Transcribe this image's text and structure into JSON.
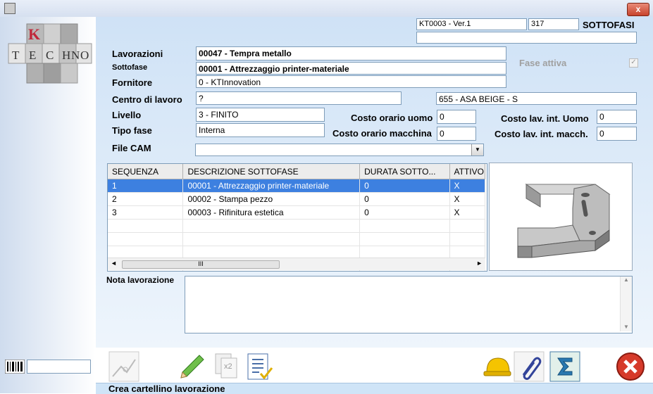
{
  "window": {
    "close_label": "x"
  },
  "header": {
    "code": "KT0003 - Ver.1",
    "number": "317",
    "title": "SOTTOFASI",
    "extra": ""
  },
  "logo": {
    "letters": [
      "K",
      "T",
      "E",
      "C",
      "H",
      "N",
      "O"
    ]
  },
  "form": {
    "lavorazioni_label": "Lavorazioni",
    "lavorazioni_value": "00047 - Tempra metallo",
    "sottofase_label": "Sottofase",
    "sottofase_value": "00001 - Attrezzaggio printer-materiale",
    "fornitore_label": "Fornitore",
    "fornitore_value": "0 - KTInnovation",
    "fase_attiva_label": "Fase attiva",
    "fase_attiva_checked": "✓",
    "centro_label": "Centro di lavoro",
    "centro_value": "?",
    "centro_desc": "655 - ASA BEIGE - S",
    "livello_label": "Livello",
    "livello_value": "3 - FINITO",
    "costo_orario_uomo_label": "Costo orario uomo",
    "costo_orario_uomo_value": "0",
    "costo_lav_uomo_label": "Costo lav. int. Uomo",
    "costo_lav_uomo_value": "0",
    "tipo_fase_label": "Tipo fase",
    "tipo_fase_value": "Interna",
    "costo_orario_macchina_label": "Costo orario macchina",
    "costo_orario_macchina_value": "0",
    "costo_lav_macch_label": "Costo lav. int. macch.",
    "costo_lav_macch_value": "0",
    "file_cam_label": "File CAM",
    "file_cam_value": ""
  },
  "table": {
    "columns": [
      "SEQUENZA",
      "DESCRIZIONE SOTTOFASE",
      "DURATA SOTTO...",
      "ATTIVO"
    ],
    "rows": [
      [
        "1",
        "00001 - Attrezzaggio printer-materiale",
        "0",
        "X"
      ],
      [
        "2",
        "00002 - Stampa pezzo",
        "0",
        "X"
      ],
      [
        "3",
        "00003 - Rifinitura estetica",
        "0",
        "X"
      ]
    ],
    "scroll_thumb": "III"
  },
  "note": {
    "label": "Nota lavorazione",
    "value": ""
  },
  "toolbar": {
    "copy_badge": "x2"
  },
  "status": {
    "text": "Crea cartellino lavorazione"
  },
  "barcode_field": ""
}
